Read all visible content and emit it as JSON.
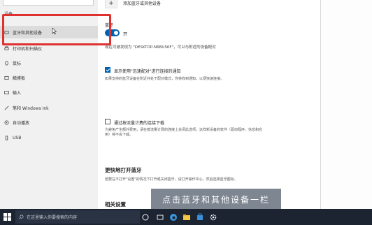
{
  "sidebar": {
    "section_label": "设备",
    "items": [
      {
        "label": "蓝牙和其他设备",
        "icon": "bluetooth-devices-icon",
        "active": true
      },
      {
        "label": "打印机和扫描仪",
        "icon": "printer-icon",
        "active": false
      },
      {
        "label": "鼠标",
        "icon": "mouse-icon",
        "active": false
      },
      {
        "label": "触摸板",
        "icon": "touchpad-icon",
        "active": false
      },
      {
        "label": "输入",
        "icon": "keyboard-icon",
        "active": false
      },
      {
        "label": "笔和 Windows Ink",
        "icon": "pen-icon",
        "active": false
      },
      {
        "label": "自动播放",
        "icon": "autoplay-icon",
        "active": false
      },
      {
        "label": "USB",
        "icon": "usb-icon",
        "active": false
      }
    ]
  },
  "content": {
    "add_device_label": "添加蓝牙或其他设备",
    "bluetooth_title": "蓝牙",
    "toggle_state": "开",
    "toggle_on": true,
    "discoverable_text": "现在可被发现为 \"DESKTOP-N6BUS6F\"，可以与附近的设备配对",
    "swift_pair": {
      "label": "显示使用\"迅速配对\"进行连接的通知",
      "checked": true,
      "description": "如果支持的蓝牙设备在附近并处于配对模式，你将收到通知，以便快速连接。"
    },
    "metered": {
      "label": "通过按流量计费的连接下载",
      "checked": false,
      "description": "为避免产生额外费用，请在按流量计费的连接上关闭此选项，这样新设备的软件（驱动程序、信息和应用）将不会下载。"
    },
    "faster_title": "更快地打开蓝牙",
    "faster_desc": "若要在不打开\"设置\"的情况下打开或关闭蓝牙，请打开操作中心，然后选择蓝牙图标。",
    "related_title": "相关设置"
  },
  "caption": "点击蓝牙和其他设备一栏",
  "taskbar": {
    "search_placeholder": "在这里输入你要搜索的内容"
  },
  "colors": {
    "accent": "#0063b1",
    "highlight_box": "#e03131",
    "taskbar": "#1c2331"
  }
}
